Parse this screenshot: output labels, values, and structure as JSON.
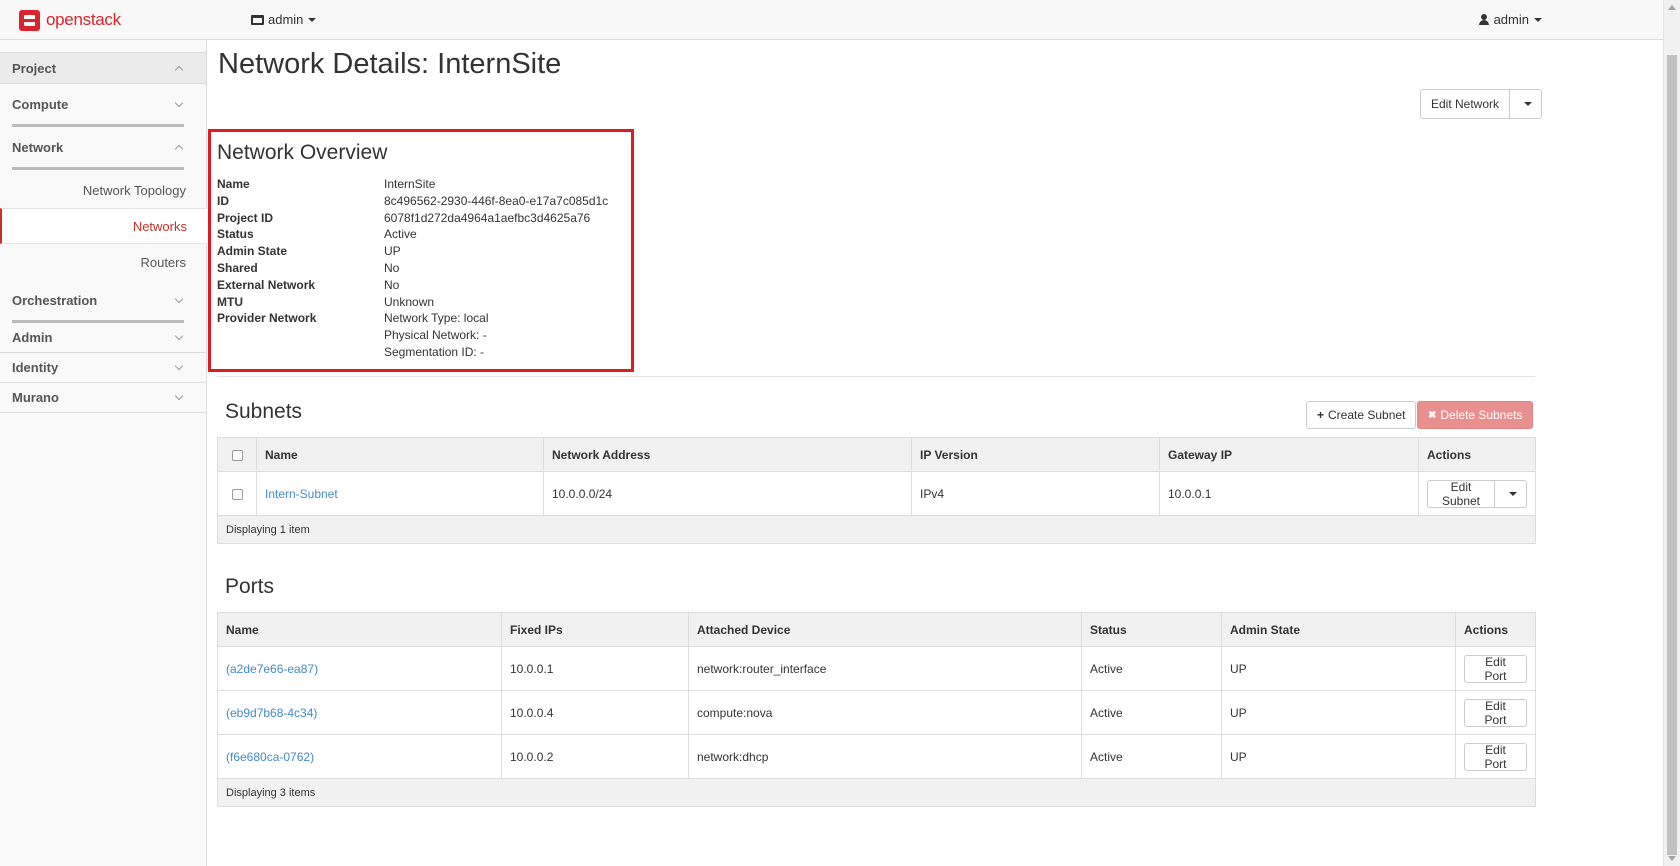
{
  "navbar": {
    "brand": "openstack",
    "project_menu": "admin",
    "user_menu": "admin"
  },
  "sidebar": {
    "groups": {
      "project": "Project",
      "compute": "Compute",
      "network": "Network",
      "orchestration": "Orchestration",
      "admin": "Admin",
      "identity": "Identity",
      "murano": "Murano"
    },
    "network_items": [
      "Network Topology",
      "Networks",
      "Routers"
    ],
    "active_item": "Networks"
  },
  "page": {
    "title": "Network Details: InternSite",
    "edit_network_label": "Edit Network"
  },
  "overview": {
    "title": "Network Overview",
    "fields": [
      {
        "label": "Name",
        "value": "InternSite"
      },
      {
        "label": "ID",
        "value": "8c496562-2930-446f-8ea0-e17a7c085d1c"
      },
      {
        "label": "Project ID",
        "value": "6078f1d272da4964a1aefbc3d4625a76"
      },
      {
        "label": "Status",
        "value": "Active"
      },
      {
        "label": "Admin State",
        "value": "UP"
      },
      {
        "label": "Shared",
        "value": "No"
      },
      {
        "label": "External Network",
        "value": "No"
      },
      {
        "label": "MTU",
        "value": "Unknown"
      },
      {
        "label": "Provider Network",
        "value": "Network Type: local"
      },
      {
        "label": "",
        "value": "Physical Network: -"
      },
      {
        "label": "",
        "value": "Segmentation ID: -"
      }
    ]
  },
  "subnets": {
    "title": "Subnets",
    "create_label": "Create Subnet",
    "delete_label": "Delete Subnets",
    "columns": [
      "Name",
      "Network Address",
      "IP Version",
      "Gateway IP",
      "Actions"
    ],
    "rows": [
      {
        "name": "Intern-Subnet",
        "network_address": "10.0.0.0/24",
        "ip_version": "IPv4",
        "gateway_ip": "10.0.0.1",
        "action": "Edit Subnet"
      }
    ],
    "footer": "Displaying 1 item"
  },
  "ports": {
    "title": "Ports",
    "columns": [
      "Name",
      "Fixed IPs",
      "Attached Device",
      "Status",
      "Admin State",
      "Actions"
    ],
    "rows": [
      {
        "name": "(a2de7e66-ea87)",
        "fixed_ips": "10.0.0.1",
        "device": "network:router_interface",
        "status": "Active",
        "admin_state": "UP",
        "action": "Edit Port"
      },
      {
        "name": "(eb9d7b68-4c34)",
        "fixed_ips": "10.0.0.4",
        "device": "compute:nova",
        "status": "Active",
        "admin_state": "UP",
        "action": "Edit Port"
      },
      {
        "name": "(f6e680ca-0762)",
        "fixed_ips": "10.0.0.2",
        "device": "network:dhcp",
        "status": "Active",
        "admin_state": "UP",
        "action": "Edit Port"
      }
    ],
    "footer": "Displaying 3 items"
  },
  "colors": {
    "brand": "#d9232d",
    "highlight_box": "#e01b24",
    "link": "#428bca",
    "danger_button": "#e8908e"
  }
}
